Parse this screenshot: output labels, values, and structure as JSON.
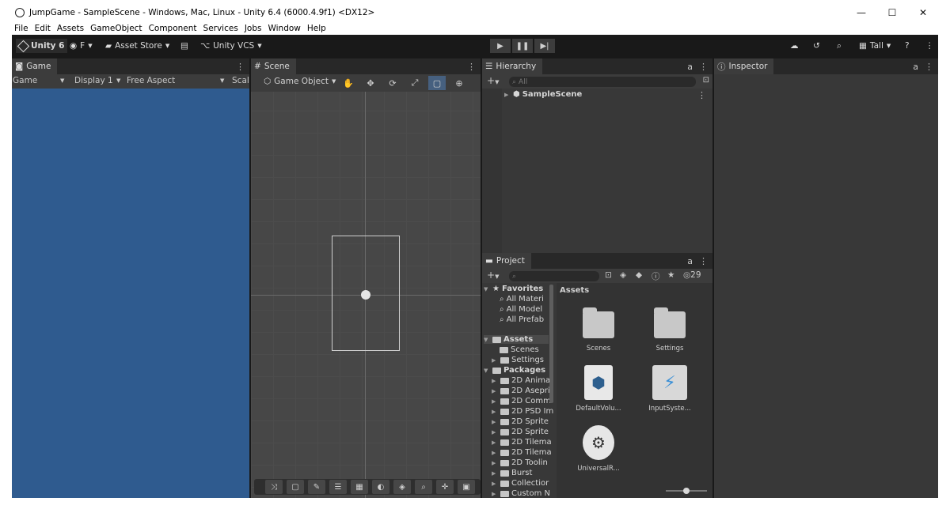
{
  "window": {
    "title": "JumpGame - SampleScene - Windows, Mac, Linux - Unity 6.4 (6000.4.9f1) <DX12>",
    "controls": [
      "—",
      "☐",
      "✕"
    ]
  },
  "menu": [
    "File",
    "Edit",
    "Assets",
    "GameObject",
    "Component",
    "Services",
    "Jobs",
    "Window",
    "Help"
  ],
  "toolbar": {
    "unity_label": "Unity 6",
    "account_label": "F",
    "asset_store_label": "Asset Store",
    "vcs_label": "Unity VCS",
    "layout_label": "Tall"
  },
  "game": {
    "tab_label": "Game",
    "mode": "Game",
    "display": "Display 1",
    "aspect": "Free Aspect",
    "scale": "Scale"
  },
  "scene": {
    "tab_label": "Scene",
    "gameobject_dropdown": "Game Object"
  },
  "hierarchy": {
    "tab_label": "Hierarchy",
    "search_placeholder": "All",
    "root": "SampleScene"
  },
  "inspector": {
    "tab_label": "Inspector"
  },
  "project": {
    "tab_label": "Project",
    "hidden_count": "29",
    "tree": {
      "favorites": "Favorites",
      "favorites_items": [
        "All Materi",
        "All Model",
        "All Prefab"
      ],
      "assets": "Assets",
      "assets_items": [
        "Scenes",
        "Settings"
      ],
      "packages": "Packages",
      "packages_items": [
        "2D Anima",
        "2D Asepri",
        "2D Comm",
        "2D PSD Im",
        "2D Sprite",
        "2D Sprite",
        "2D Tilema",
        "2D Tilema",
        "2D Toolin",
        "Burst",
        "Collectior",
        "Custom N"
      ]
    },
    "breadcrumb": "Assets",
    "assets_grid": [
      "Scenes",
      "Settings",
      "DefaultVolu...",
      "InputSyste...",
      "UniversalR..."
    ]
  },
  "colors": {
    "editor_bg": "#383838",
    "toolbar_bg": "#191919",
    "game_bg": "#2f5b8f",
    "scene_bg": "#474747"
  }
}
